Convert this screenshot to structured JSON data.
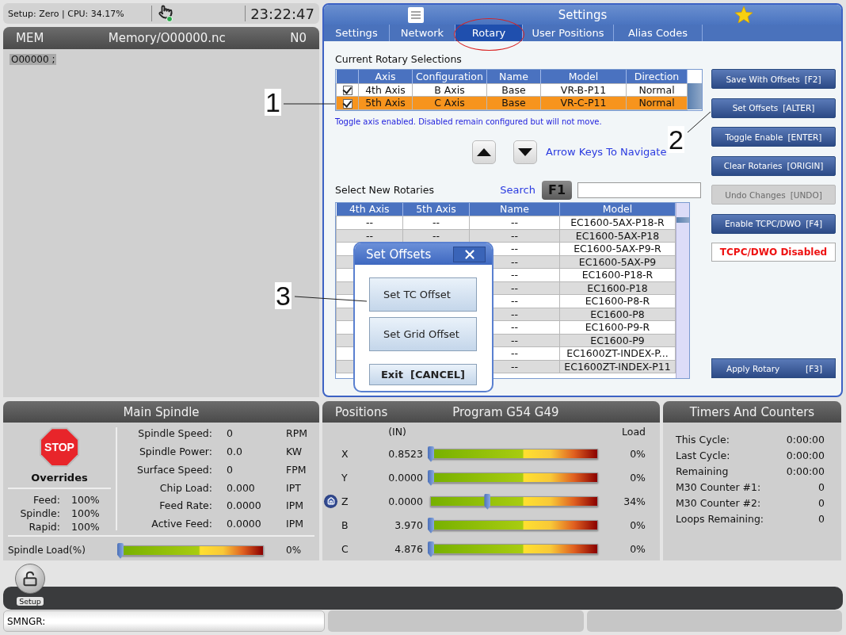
{
  "top_status": {
    "setup": "Setup: Zero | CPU: 34.17%",
    "clock": "23:22:47"
  },
  "program_panel": {
    "mode": "MEM",
    "file": "Memory/O00000.nc",
    "line_number": "N0",
    "code_lines": [
      {
        "text": "O00000 ;",
        "selected": true
      }
    ]
  },
  "settings": {
    "title": "Settings",
    "tabs": [
      {
        "label": "Settings",
        "selected": false,
        "circled": false
      },
      {
        "label": "Network",
        "selected": false,
        "circled": false
      },
      {
        "label": "Rotary",
        "selected": true,
        "circled": true
      },
      {
        "label": "User Positions",
        "selected": false,
        "circled": false
      },
      {
        "label": "Alias Codes",
        "selected": false,
        "circled": false
      }
    ],
    "current_rotary": {
      "title": "Current Rotary Selections",
      "columns": [
        "Axis",
        "Configuration",
        "Name",
        "Model",
        "Direction"
      ],
      "rows": [
        {
          "enabled": true,
          "selected": false,
          "axis": "4th Axis",
          "configuration": "B Axis",
          "name": "Base",
          "model": "VR-B-P11",
          "direction": "Normal"
        },
        {
          "enabled": true,
          "selected": true,
          "axis": "5th Axis",
          "configuration": "C Axis",
          "name": "Base",
          "model": "VR-C-P11",
          "direction": "Normal"
        }
      ],
      "hint": "Toggle axis enabled. Disabled remain configured but will not move."
    },
    "navigate_hint": "Arrow Keys To Navigate",
    "new_rotaries": {
      "title": "Select New Rotaries",
      "search_label": "Search",
      "search_key": "F1",
      "columns": [
        "4th Axis",
        "5th Axis",
        "Name",
        "Model"
      ],
      "rows": [
        {
          "axis_4th": "--",
          "axis_5th": "--",
          "name": "--",
          "model": "EC1600-5AX-P18-R"
        },
        {
          "axis_4th": "--",
          "axis_5th": "--",
          "name": "--",
          "model": "EC1600-5AX-P18"
        },
        {
          "name": "--",
          "model": "EC1600-5AX-P9-R"
        },
        {
          "name": "--",
          "model": "EC1600-5AX-P9"
        },
        {
          "name": "--",
          "model": "EC1600-P18-R"
        },
        {
          "name": "--",
          "model": "EC1600-P18"
        },
        {
          "name": "--",
          "model": "EC1600-P8-R"
        },
        {
          "name": "--",
          "model": "EC1600-P8"
        },
        {
          "name": "--",
          "model": "EC1600-P9-R"
        },
        {
          "name": "--",
          "model": "EC1600-P9"
        },
        {
          "name": "--",
          "model": "EC1600ZT-INDEX-P..."
        },
        {
          "name": "--",
          "model": "EC1600ZT-INDEX-P11"
        }
      ]
    },
    "actions": [
      {
        "label": "Save With Offsets",
        "key": "[F2]",
        "disabled": false
      },
      {
        "label": "Set Offsets",
        "key": "[ALTER]",
        "disabled": false
      },
      {
        "label": "Toggle Enable",
        "key": "[ENTER]",
        "disabled": false
      },
      {
        "label": "Clear Rotaries",
        "key": "[ORIGIN]",
        "disabled": false
      },
      {
        "label": "Undo Changes",
        "key": "[UNDO]",
        "disabled": true
      },
      {
        "label": "Enable TCPC/DWO",
        "key": "[F4]",
        "disabled": false
      }
    ],
    "tcpc_status": "TCPC/DWO Disabled",
    "apply_button": {
      "label": "Apply Rotary",
      "key": "[F3]"
    },
    "dialog": {
      "title": "Set Offsets",
      "buttons": [
        {
          "label": "Set TC Offset",
          "kind": "option"
        },
        {
          "label": "Set Grid Offset",
          "kind": "option"
        },
        {
          "label": "Exit  [CANCEL]",
          "kind": "exit"
        }
      ]
    }
  },
  "callouts": [
    {
      "label": "1"
    },
    {
      "label": "2"
    },
    {
      "label": "3"
    }
  ],
  "spindle": {
    "title": "Main Spindle",
    "stop_sign": "STOP",
    "overrides_title": "Overrides",
    "overrides": [
      {
        "label": "Feed:",
        "value": "100%"
      },
      {
        "label": "Spindle:",
        "value": "100%"
      },
      {
        "label": "Rapid:",
        "value": "100%"
      }
    ],
    "readings": [
      {
        "label": "Spindle Speed:",
        "value": "0",
        "unit": "RPM"
      },
      {
        "label": "Spindle Power:",
        "value": "0.0",
        "unit": "KW"
      },
      {
        "label": "Surface Speed:",
        "value": "0",
        "unit": "FPM"
      },
      {
        "label": "Chip Load:",
        "value": "0.000",
        "unit": "IPT"
      },
      {
        "label": "Feed Rate:",
        "value": "0.0000",
        "unit": "IPM"
      },
      {
        "label": "Active Feed:",
        "value": "0.0000",
        "unit": "IPM"
      }
    ],
    "load": {
      "label": "Spindle Load(%)",
      "level": 0,
      "reading": "0%"
    }
  },
  "positions": {
    "title": "Positions",
    "program": "Program G54 G49",
    "units": "(IN)",
    "load_heading": "Load",
    "axes": [
      {
        "axis": "X",
        "value": "0.8523",
        "level": 0,
        "reading": "0%",
        "home": false
      },
      {
        "axis": "Y",
        "value": "0.0000",
        "level": 0,
        "reading": "0%",
        "home": false
      },
      {
        "axis": "Z",
        "value": "0.0000",
        "level": 0.34,
        "reading": "34%",
        "home": true
      },
      {
        "axis": "B",
        "value": "3.970",
        "level": 0,
        "reading": "0%",
        "home": false
      },
      {
        "axis": "C",
        "value": "4.876",
        "level": 0,
        "reading": "0%",
        "home": false
      }
    ]
  },
  "timers": {
    "title": "Timers And Counters",
    "rows": [
      {
        "label": "This Cycle:",
        "value": "0:00:00"
      },
      {
        "label": "Last Cycle:",
        "value": "0:00:00"
      },
      {
        "label": "Remaining",
        "value": "0:00:00"
      },
      {
        "label": "M30 Counter #1:",
        "value": "0"
      },
      {
        "label": "M30 Counter #2:",
        "value": "0"
      },
      {
        "label": "Loops Remaining:",
        "value": "0"
      }
    ]
  },
  "setup_button": {
    "label": "Setup"
  },
  "command_line": {
    "value": "SMNGR:"
  }
}
